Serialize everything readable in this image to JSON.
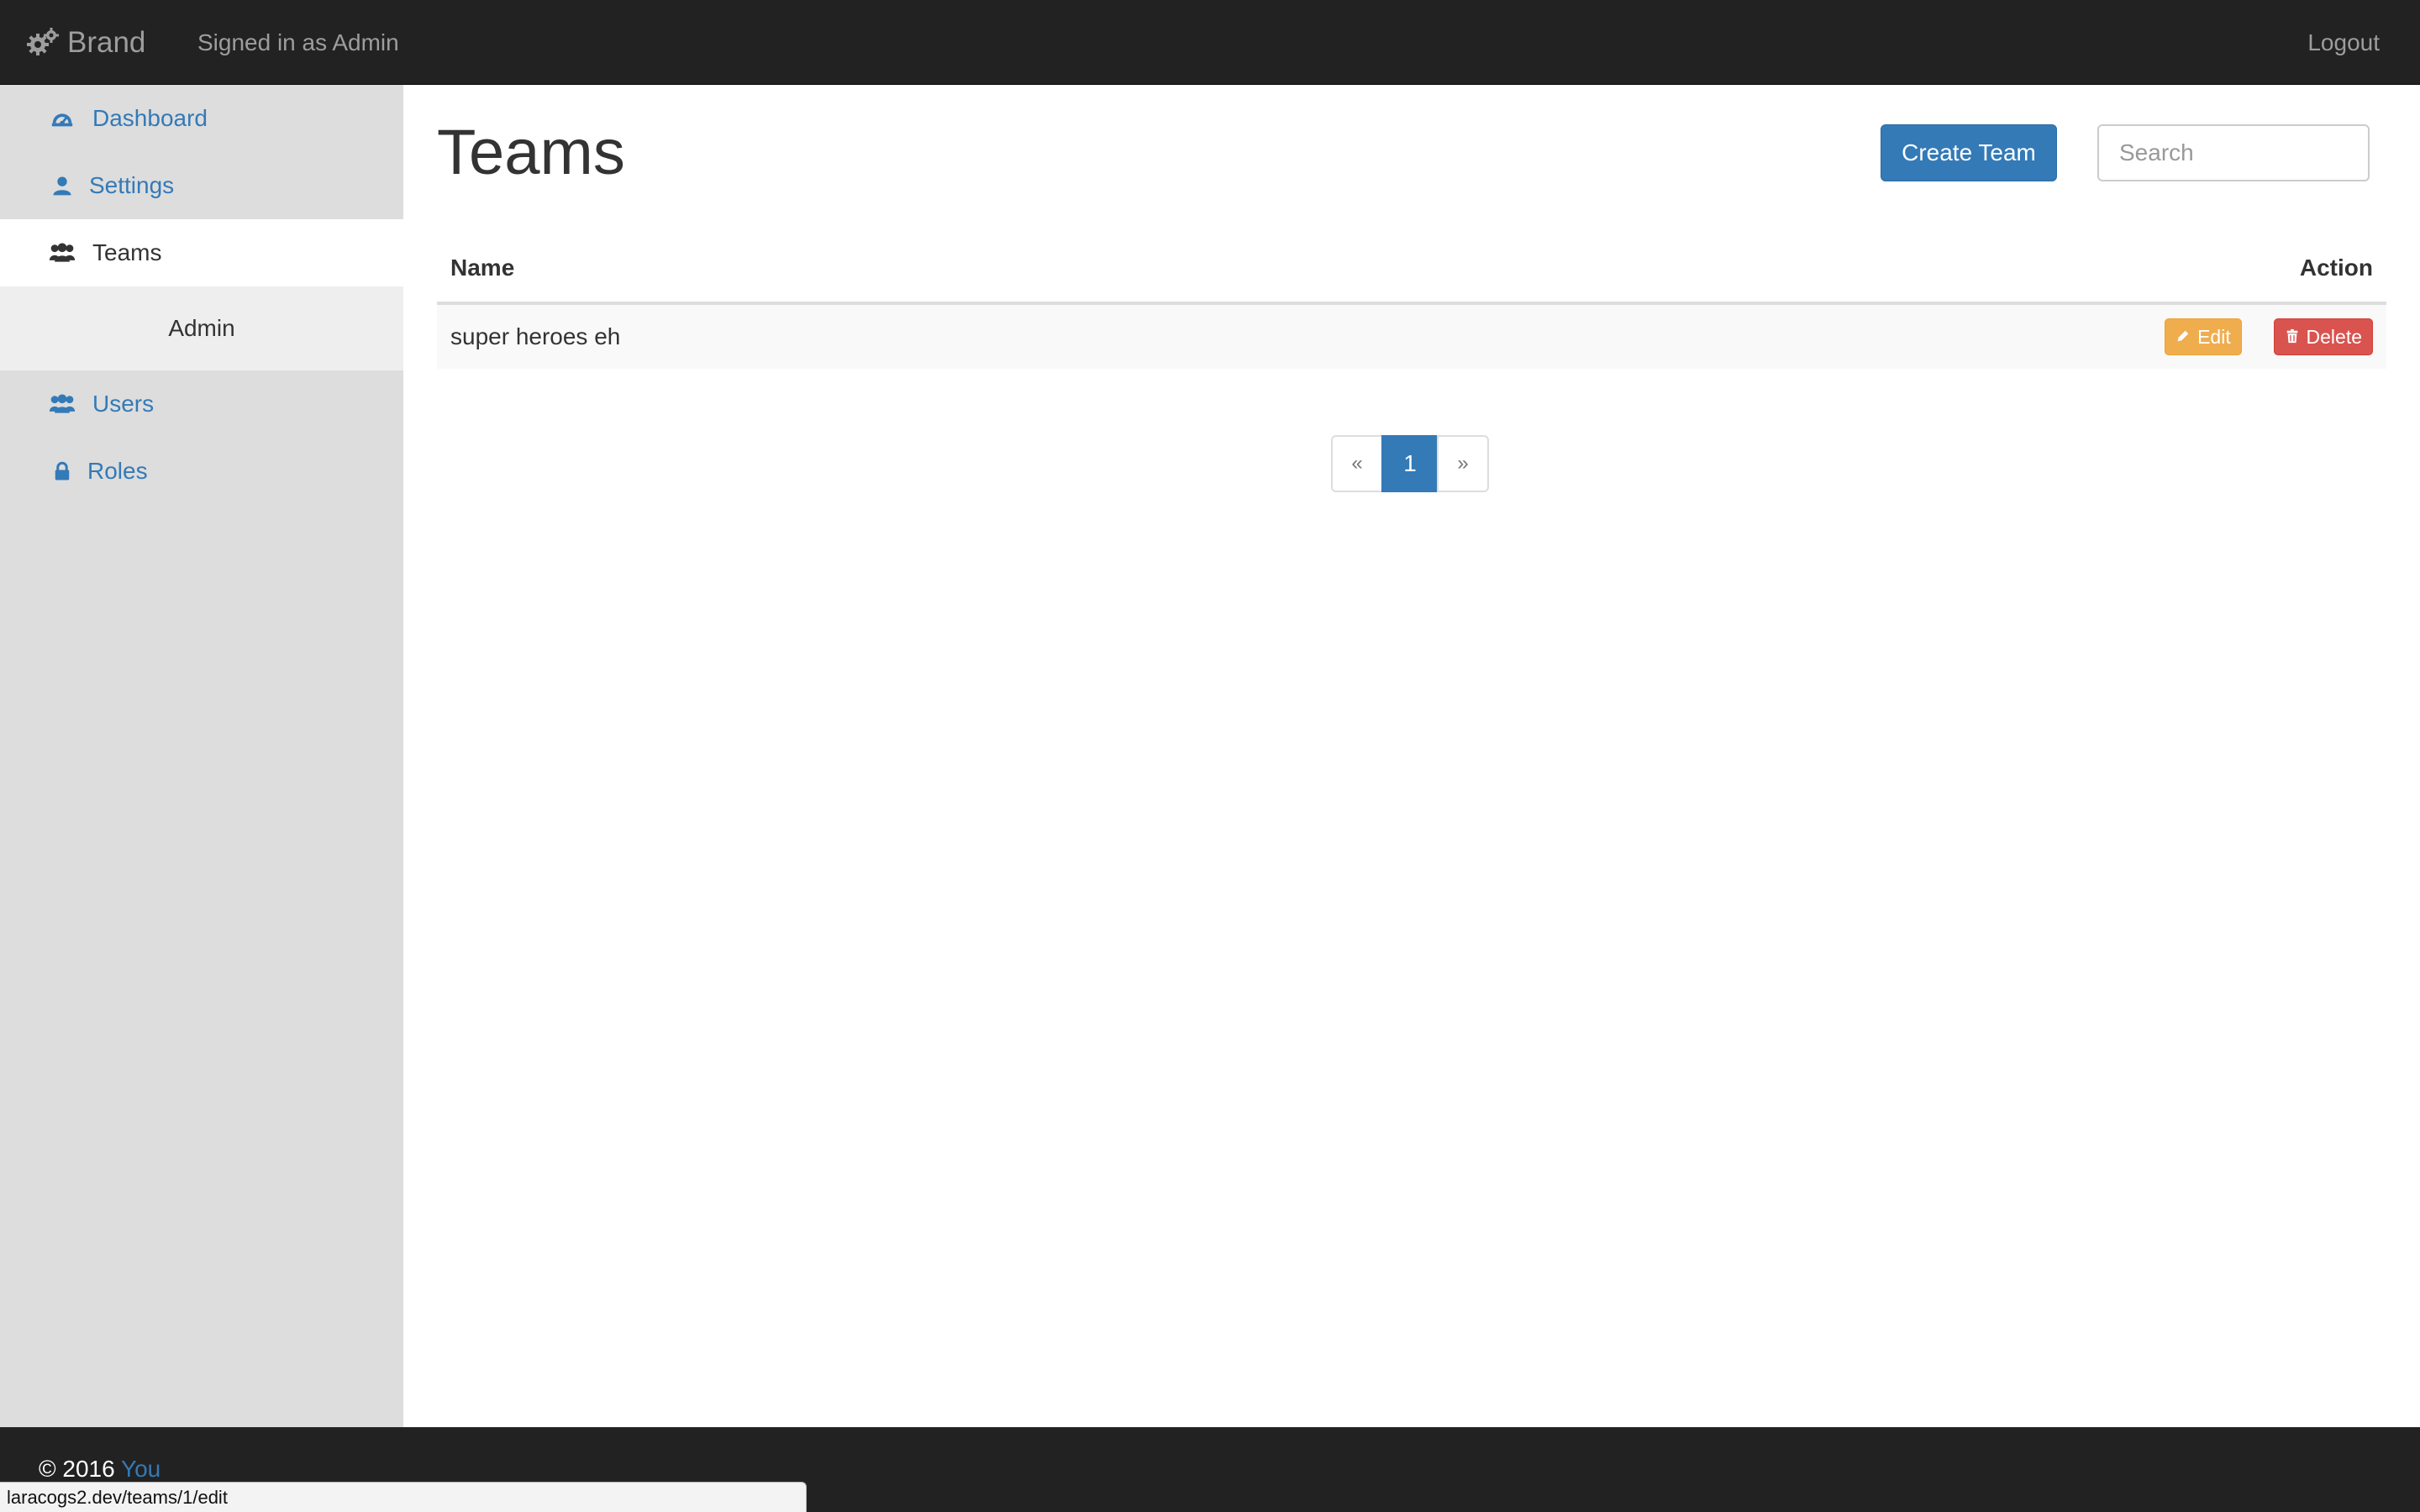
{
  "navbar": {
    "brand": "Brand",
    "signed_in": "Signed in as Admin",
    "logout": "Logout"
  },
  "sidebar": {
    "items": [
      {
        "label": "Dashboard",
        "icon": "dashboard-icon"
      },
      {
        "label": "Settings",
        "icon": "user-icon"
      },
      {
        "label": "Teams",
        "icon": "users-icon",
        "active": true
      }
    ],
    "admin_heading": "Admin",
    "admin_items": [
      {
        "label": "Users",
        "icon": "users-icon"
      },
      {
        "label": "Roles",
        "icon": "lock-icon"
      }
    ]
  },
  "main": {
    "title": "Teams",
    "create_button": "Create Team",
    "search_placeholder": "Search",
    "table": {
      "headers": [
        "Name",
        "Action"
      ],
      "rows": [
        {
          "name": "super heroes eh",
          "edit_label": "Edit",
          "delete_label": "Delete"
        }
      ]
    },
    "pagination": {
      "prev": "«",
      "current": "1",
      "next": "»"
    }
  },
  "footer": {
    "copyright": "© 2016",
    "link": "You"
  },
  "status_bar": {
    "url": "laracogs2.dev/teams/1/edit"
  },
  "colors": {
    "navbar_bg": "#222222",
    "sidebar_bg": "#dddddd",
    "primary": "#337ab7",
    "warning": "#f0ad4e",
    "danger": "#d9534f"
  }
}
